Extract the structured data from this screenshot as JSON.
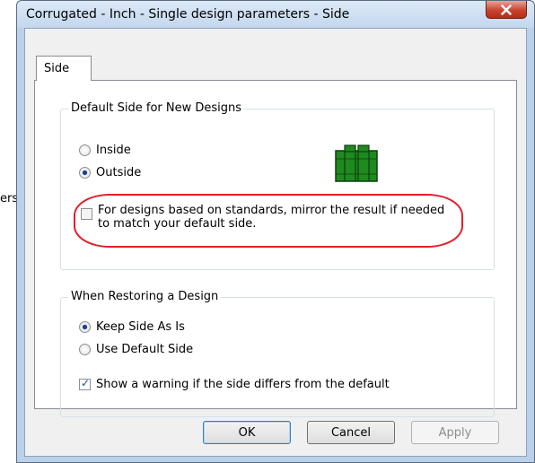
{
  "background": {
    "fragment_text": "ers"
  },
  "dialog": {
    "title": "Corrugated - Inch - Single design parameters - Side",
    "close_icon": "close-x-icon",
    "tabs": [
      {
        "label": "Side",
        "selected": true
      }
    ],
    "default_side_group": {
      "title": "Default Side for New Designs",
      "options": [
        {
          "label": "Inside",
          "selected": false
        },
        {
          "label": "Outside",
          "selected": true
        }
      ],
      "preview_icon": "box-outside-preview-icon",
      "mirror_checkbox": {
        "label": "For designs based on standards, mirror the result if needed to match your default side.",
        "checked": false
      }
    },
    "restore_group": {
      "title": "When Restoring a Design",
      "options": [
        {
          "label": "Keep Side As Is",
          "selected": true
        },
        {
          "label": "Use Default Side",
          "selected": false
        }
      ],
      "warning_checkbox": {
        "label": "Show a warning if the side differs from the default",
        "checked": true
      }
    },
    "buttons": {
      "ok": "OK",
      "cancel": "Cancel",
      "apply": "Apply"
    },
    "colors": {
      "highlight": "#e0202a",
      "close_button": "#c7442f",
      "preview_green": "#1f8a1f"
    }
  }
}
